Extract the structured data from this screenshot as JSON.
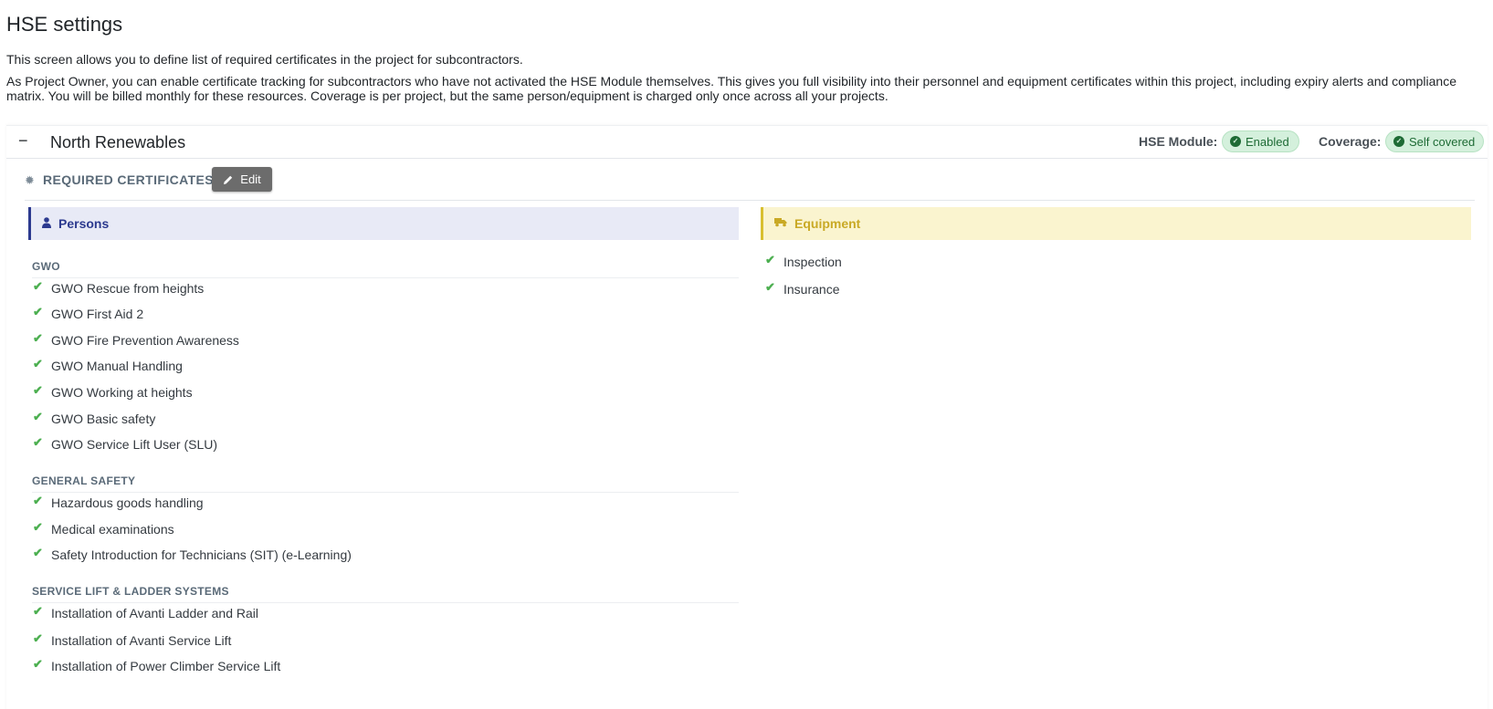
{
  "page": {
    "title": "HSE settings",
    "intro_1": "This screen allows you to define list of required certificates in the project for subcontractors.",
    "intro_2": "As Project Owner, you can enable certificate tracking for subcontractors who have not activated the HSE Module themselves. This gives you full visibility into their personnel and equipment certificates within this project, including expiry alerts and compliance matrix. You will be billed monthly for these resources. Coverage is per project, but the same person/equipment is charged only once across all your projects."
  },
  "project": {
    "collapse_symbol": "−",
    "name": "North Renewables",
    "hse_module_label": "HSE Module:",
    "hse_module_status": "Enabled",
    "coverage_label": "Coverage:",
    "coverage_status": "Self covered",
    "status_color": "#1e6b35"
  },
  "required": {
    "title": "REQUIRED CERTIFICATES",
    "edit_label": "Edit"
  },
  "persons": {
    "label": "Persons",
    "accent": "#2c3a8f",
    "groups": [
      {
        "title": "GWO",
        "items": [
          "GWO Rescue from heights",
          "GWO First Aid 2",
          "GWO Fire Prevention Awareness",
          "GWO Manual Handling",
          "GWO Working at heights",
          "GWO Basic safety",
          "GWO Service Lift User (SLU)"
        ]
      },
      {
        "title": "GENERAL SAFETY",
        "items": [
          "Hazardous goods handling",
          "Medical examinations",
          "Safety Introduction for Technicians (SIT) (e-Learning)"
        ]
      },
      {
        "title": "SERVICE LIFT & LADDER SYSTEMS",
        "items": [
          "Installation of Avanti Ladder and Rail",
          "Installation of Avanti Service Lift",
          "Installation of Power Climber Service Lift"
        ]
      }
    ]
  },
  "equipment": {
    "label": "Equipment",
    "accent": "#c9a925",
    "items": [
      "Inspection",
      "Insurance"
    ]
  },
  "icons": {
    "check": "check-icon",
    "gear": "gear-icon",
    "pencil": "pencil-icon",
    "user": "user-icon",
    "truck": "truck-icon"
  }
}
